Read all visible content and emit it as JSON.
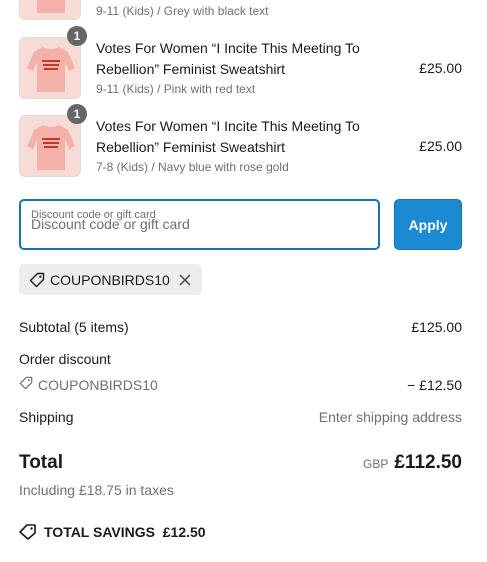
{
  "items": [
    {
      "quantity": "",
      "name": "",
      "variant": "9-11 (Kids) / Grey with black text",
      "price": ""
    },
    {
      "quantity": "1",
      "name": "Votes For Women “I Incite This Meeting To Rebellion” Feminist Sweatshirt",
      "variant": "9-11 (Kids) / Pink with red text",
      "price": "£25.00"
    },
    {
      "quantity": "1",
      "name": "Votes For Women “I Incite This Meeting To Rebellion” Feminist Sweatshirt",
      "variant": "7-8 (Kids) / Navy blue with rose gold",
      "price": "£25.00"
    }
  ],
  "discount": {
    "label": "Discount code or gift card",
    "placeholder": "Discount code or gift card",
    "apply_label": "Apply",
    "applied_code": "COUPONBIRDS10"
  },
  "summary": {
    "subtotal_label": "Subtotal (5 items)",
    "subtotal_value": "£125.00",
    "order_discount_label": "Order discount",
    "discount_code": "COUPONBIRDS10",
    "discount_value": "− £12.50",
    "shipping_label": "Shipping",
    "shipping_value": "Enter shipping address",
    "total_label": "Total",
    "currency": "GBP",
    "total_value": "£112.50",
    "taxes_note": "Including £18.75 in taxes",
    "savings_label": "TOTAL SAVINGS",
    "savings_value": "£12.50"
  },
  "colors": {
    "accent": "#1773b0",
    "apply_button": "#1b8ad3",
    "chip_bg": "#ededed",
    "muted_text": "#707070",
    "sweatshirt_pink": "#f3b1aa",
    "print_red": "#c0392b"
  },
  "icons": {
    "tag": "tag-icon",
    "remove": "close-icon",
    "savings": "tag-icon"
  }
}
